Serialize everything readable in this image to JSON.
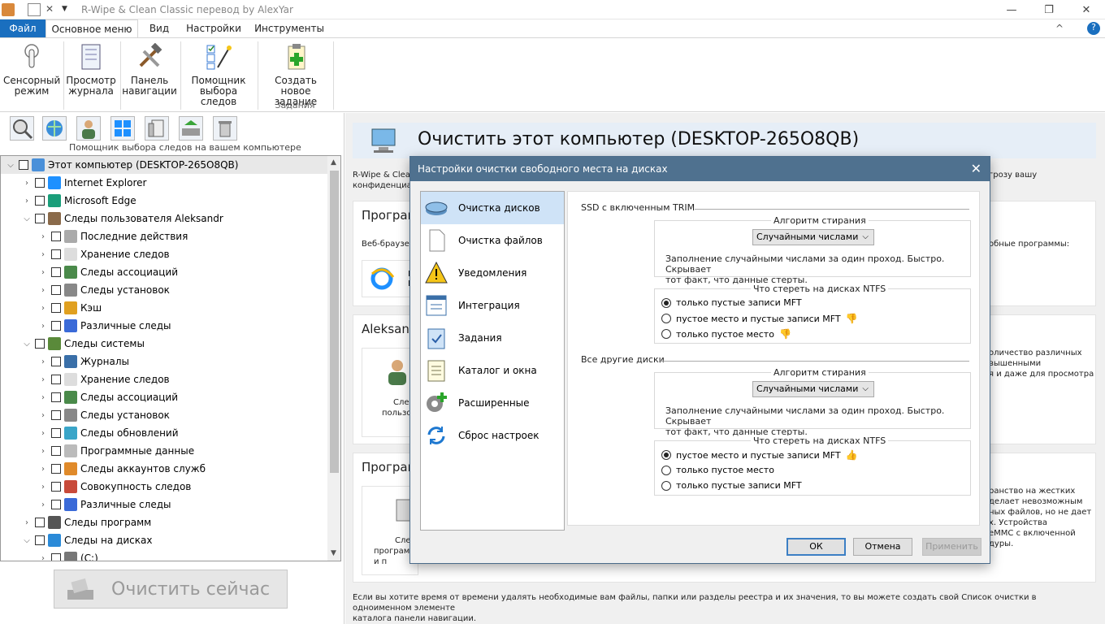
{
  "window": {
    "title": "R-Wipe & Clean Classic перевод by AlexYar",
    "minimize": "—",
    "restore": "❐",
    "close": "✕"
  },
  "ribbon": {
    "tabs": [
      "Файл",
      "Основное меню",
      "Вид",
      "Настройки",
      "Инструменты"
    ],
    "buttons": [
      {
        "line1": "Сенсорный",
        "line2": "режим"
      },
      {
        "line1": "Просмотр",
        "line2": "журнала"
      },
      {
        "line1": "Панель",
        "line2": "навигации"
      },
      {
        "line1": "Помощник",
        "line2": "выбора следов"
      },
      {
        "line1": "Создать новое",
        "line2": "задание"
      }
    ],
    "group_label": "Задания",
    "help": "?",
    "collapse": "^"
  },
  "tools_caption": "Помощник выбора следов на вашем компьютере",
  "tree": {
    "items": [
      {
        "label": "Этот компьютер  (DESKTOP-265O8QB)",
        "expanded": true
      },
      {
        "label": "Internet  Explorer"
      },
      {
        "label": "Microsoft Edge"
      },
      {
        "label": "Следы пользователя Aleksandr",
        "expanded": true
      },
      {
        "label": "Последние действия"
      },
      {
        "label": "Хранение следов"
      },
      {
        "label": "Следы ассоциаций"
      },
      {
        "label": "Следы установок"
      },
      {
        "label": "Кэш"
      },
      {
        "label": "Различные следы"
      },
      {
        "label": "Следы системы",
        "expanded": true
      },
      {
        "label": "Журналы"
      },
      {
        "label": "Хранение следов"
      },
      {
        "label": "Следы ассоциаций"
      },
      {
        "label": "Следы установок"
      },
      {
        "label": "Следы обновлений"
      },
      {
        "label": "Программные данные"
      },
      {
        "label": "Следы аккаунтов служб"
      },
      {
        "label": "Совокупность следов"
      },
      {
        "label": "Различные следы"
      },
      {
        "label": "Следы программ"
      },
      {
        "label": "Следы на дисках",
        "expanded": true
      },
      {
        "label": "(C:)"
      }
    ]
  },
  "clean_now": "Очистить сейчас",
  "main": {
    "title": "Очистить этот компьютер  (DESKTOP-265O8QB)",
    "intro_l1": "R-Wipe & Clea",
    "intro_l2": "конфиденциал",
    "intro_r": "грозу вашу",
    "sec_programs": "Програм",
    "browsers_text": "Веб-браузер",
    "ie_l1": "In",
    "ie_l2": "E",
    "browsers_right": "обные программы:",
    "sec_user": "Aleksand",
    "user_card_l1": "След",
    "user_card_l2": "пользов",
    "user_right_l1": "оличество различных",
    "user_right_l2": "вышенными",
    "user_right_l3": "я и даже для просмотра",
    "sec_programs2": "Програм",
    "prog_card_l1": "След",
    "prog_card_l2": "программ и п",
    "disk_right_l1": "ранство на жестких",
    "disk_right_l2": "делает невозможным",
    "disk_right_l3": "ных файлов, но не дает",
    "disk_right_l4": "х. Устройства",
    "disk_right_l5": "eMMC с включенной",
    "disk_right_l6": "дуры.",
    "footer_l1": "Если вы хотите время от времени удалять необходимые вам файлы, папки или разделы реестра и их значения, то вы можете создать свой Список очистки в одноименном элементе",
    "footer_l2": "каталога  панели навигации."
  },
  "dialog": {
    "title": "Настройки очистки свободного места на дисках",
    "close": "✕",
    "nav": [
      {
        "label": "Очистка дисков",
        "selected": true
      },
      {
        "label": "Очистка файлов"
      },
      {
        "label": "Уведомления"
      },
      {
        "label": "Интеграция"
      },
      {
        "label": "Задания"
      },
      {
        "label": "Каталог и окна"
      },
      {
        "label": "Расширенные"
      },
      {
        "label": "Сброс настроек"
      }
    ],
    "ssd": {
      "header": "SSD с включенным TRIM",
      "algo_title": "Алгоритм стирания",
      "algo_value": "Случайными числами",
      "algo_desc_l1": "Заполнение случайными числами за один проход. Быстро. Скрывает",
      "algo_desc_l2": "тот факт, что данные стерты.",
      "ntfs_title": "Что стереть на дисках NTFS",
      "options": [
        {
          "label": "только пустые записи MFT",
          "checked": true
        },
        {
          "label": "пустое место и пустые записи MFT",
          "thumb": "down"
        },
        {
          "label": "только пустое место",
          "thumb": "down"
        }
      ]
    },
    "other": {
      "header": "Все другие диски",
      "algo_title": "Алгоритм стирания",
      "algo_value": "Случайными числами",
      "algo_desc_l1": "Заполнение случайными числами за один проход. Быстро. Скрывает",
      "algo_desc_l2": "тот факт, что данные стерты.",
      "ntfs_title": "Что стереть на дисках NTFS",
      "options": [
        {
          "label": "пустое место и пустые записи MFT",
          "checked": true,
          "thumb": "up"
        },
        {
          "label": "только пустое место"
        },
        {
          "label": "только пустые записи MFT"
        }
      ]
    },
    "buttons": {
      "ok": "ОК",
      "cancel": "Отмена",
      "apply": "Применить"
    },
    "thumb_down": "👎",
    "thumb_up": "👍"
  },
  "colors": {
    "accent": "#1a6fbf",
    "dialog_title": "#4f718f",
    "nav_selected": "#cfe3f7"
  }
}
